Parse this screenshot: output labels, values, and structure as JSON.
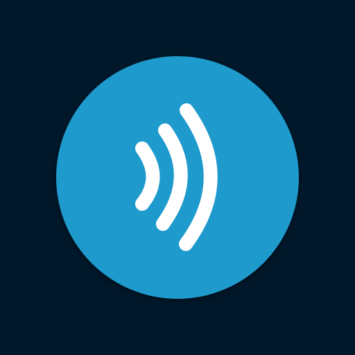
{
  "background_color": "#01182A",
  "icon": {
    "name": "contactless-signal-icon",
    "shape": "circle",
    "fill_color": "#1E9ACD",
    "glyph_color": "#FFFFFF",
    "wave_count": 3
  }
}
